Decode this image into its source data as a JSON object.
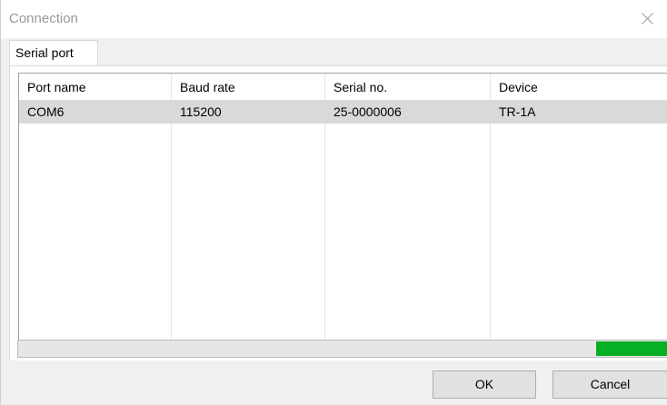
{
  "window": {
    "title": "Connection"
  },
  "tabs": [
    {
      "label": "Serial port",
      "selected": true
    }
  ],
  "table": {
    "columns": [
      "Port name",
      "Baud rate",
      "Serial no.",
      "Device"
    ],
    "rows": [
      {
        "port_name": "COM6",
        "baud_rate": "115200",
        "serial_no": "25-0000006",
        "device": "TR-1A",
        "selected": true
      }
    ]
  },
  "progress": {
    "fraction": 0.11,
    "color": "#06b025"
  },
  "buttons": {
    "ok": "OK",
    "cancel": "Cancel"
  },
  "colors": {
    "selected_row": "#d9d9d9",
    "dialog_bg": "#f0f0f0",
    "title_text": "#999999"
  },
  "icons": {
    "close": "close-icon"
  }
}
